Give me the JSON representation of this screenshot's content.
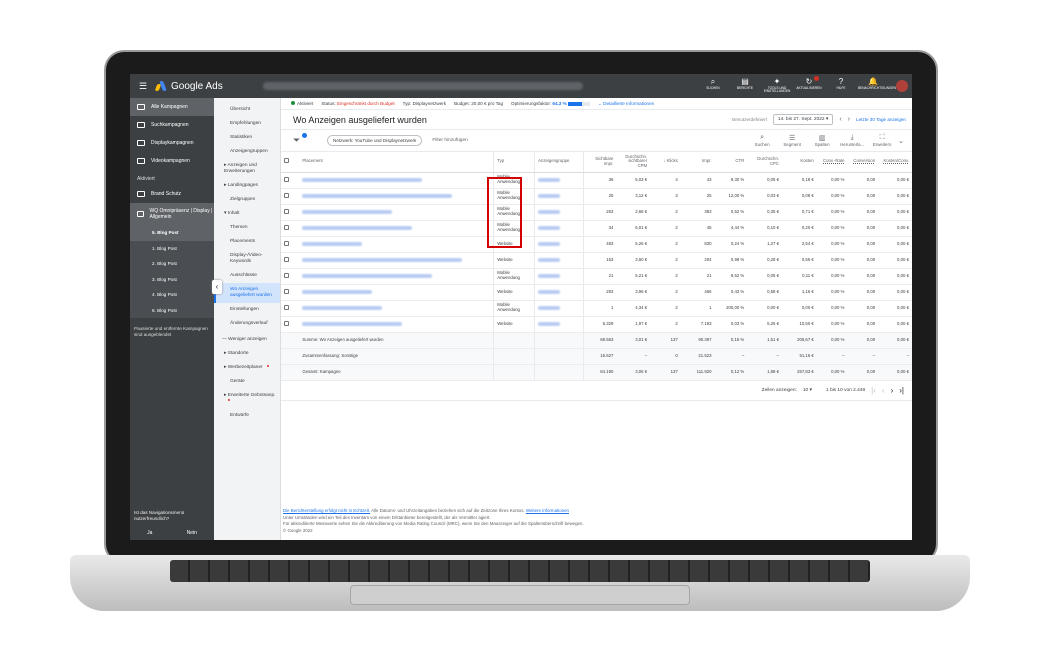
{
  "app": {
    "title": "Google Ads"
  },
  "topbar": {
    "actions": [
      {
        "icon": "search-icon",
        "glyph": "⌕",
        "label": "SUCHEN"
      },
      {
        "icon": "reports-icon",
        "glyph": "▤",
        "label": "BERICHTE"
      },
      {
        "icon": "wrench-icon",
        "glyph": "✦",
        "label": "TOOLS UND EINSTELLUNGEN"
      },
      {
        "icon": "refresh-icon",
        "glyph": "↻",
        "label": "AKTUALISIEREN"
      },
      {
        "icon": "help-icon",
        "glyph": "?",
        "label": "HILFE"
      },
      {
        "icon": "bell-icon",
        "glyph": "🔔",
        "label": "BENACHRICHTIGUNGEN"
      }
    ]
  },
  "leftnav": {
    "items": [
      {
        "label": "Alle Kampagnen"
      },
      {
        "label": "Suchkampagnen"
      },
      {
        "label": "Displaykampagnen"
      },
      {
        "label": "Videokampagnen"
      }
    ],
    "section_label": "Aktiviert",
    "campaigns": [
      {
        "label": "Brand Schutz"
      },
      {
        "label": "WQ Omnipräsenz | Display | Allgemein"
      }
    ],
    "adgroups": [
      "5. Blog Post",
      "1. Blog Post",
      "2. Blog Post",
      "3. Blog Post",
      "4. Blog Post",
      "6. Blog Post"
    ],
    "paused_note": "Pausierte und entfernte Kampagnen sind ausgeblendet",
    "feedback_question": "Ist das Navigationsmenü nutzerfreundlich?",
    "yes": "Ja",
    "no": "Nein"
  },
  "subnav": {
    "items": [
      {
        "label": "Übersicht"
      },
      {
        "label": "Empfehlungen"
      },
      {
        "label": "Statistiken"
      },
      {
        "label": "Anzeigengruppen"
      },
      {
        "label": "Anzeigen und Erweiterungen"
      },
      {
        "label": "Landingpages"
      },
      {
        "label": "Zielgruppen"
      },
      {
        "label": "Inhalt"
      },
      {
        "label": "Themen"
      },
      {
        "label": "Placements"
      },
      {
        "label": "Display-/Video-Keywords"
      },
      {
        "label": "Ausschlüsse"
      },
      {
        "label": "Wo Anzeigen ausgeliefert wurden"
      },
      {
        "label": "Einstellungen"
      },
      {
        "label": "Änderungsverlauf"
      }
    ],
    "less_label": "Weniger anzeigen",
    "extra": [
      {
        "label": "Standorte"
      },
      {
        "label": "Werbezeitplaner"
      },
      {
        "label": "Geräte"
      },
      {
        "label": "Erweiterte Gebotsanp."
      },
      {
        "label": "Entwürfe"
      }
    ]
  },
  "statusbar": {
    "status": "Aktiviert",
    "status_prefix": "Status:",
    "status_value": "Eingeschränkt durch Budget",
    "type_prefix": "Typ:",
    "type_value": "Displaynetzwerk",
    "budget_prefix": "Budget:",
    "budget_value": "20,00 € pro Tag",
    "opt_label": "Optimierungsfaktor:",
    "opt_value": "64,3 %",
    "opt_fraction": 0.643,
    "details_link": "Detaillierte Informationen",
    "colors": {
      "green": "#1e8e3e",
      "red": "#d93025",
      "blue": "#1a73e8"
    }
  },
  "header": {
    "title": "Wo Anzeigen ausgeliefert wurden",
    "date_label": "Benutzerdefiniert",
    "date_value": "14. bis 27. Sept. 2022",
    "last30": "Letzte 30 Tage anzeigen"
  },
  "toolbar": {
    "network_chip": "Netzwerk: YouTube und Displaynetzwerk",
    "add_filter": "Filter hinzufügen",
    "tools": [
      {
        "icon": "search-icon",
        "glyph": "⌕",
        "label": "Suchen"
      },
      {
        "icon": "segment-icon",
        "glyph": "☰",
        "label": "Segment"
      },
      {
        "icon": "columns-icon",
        "glyph": "▥",
        "label": "Spalten"
      },
      {
        "icon": "download-icon",
        "glyph": "⤓",
        "label": "Herunterla..."
      },
      {
        "icon": "expand-icon",
        "glyph": "⛶",
        "label": "Erweitern"
      }
    ]
  },
  "table": {
    "headers": [
      "Placement",
      "Typ",
      "Anzeigengruppe",
      "Sichtbare Impr.",
      "Durchschn. sichtbarer CPM",
      "Klicks",
      "Impr.",
      "CTR",
      "Durchschn. CPC",
      "Kosten",
      "Conv.-Rate",
      "Conversion",
      "Kosten/Conv."
    ],
    "rows": [
      {
        "typ": "Mobile Anwendung",
        "vimpr": "36",
        "vcpm": "5,03 €",
        "clicks": "4",
        "impr": "43",
        "ctr": "9,30 %",
        "cpc": "0,05 €",
        "cost": "0,18 €",
        "cr": "0,00 %",
        "conv": "0,00",
        "cpconv": "0,00 €"
      },
      {
        "typ": "Mobile Anwendung",
        "vimpr": "25",
        "vcpm": "3,12 €",
        "clicks": "3",
        "impr": "25",
        "ctr": "12,00 %",
        "cpc": "0,03 €",
        "cost": "0,08 €",
        "cr": "0,00 %",
        "conv": "0,00",
        "cpconv": "0,00 €"
      },
      {
        "typ": "Mobile Anwendung",
        "vimpr": "263",
        "vcpm": "2,68 €",
        "clicks": "2",
        "impr": "383",
        "ctr": "0,52 %",
        "cpc": "0,35 €",
        "cost": "0,71 €",
        "cr": "0,00 %",
        "conv": "0,00",
        "cpconv": "0,00 €"
      },
      {
        "typ": "Mobile Anwendung",
        "vimpr": "34",
        "vcpm": "6,01 €",
        "clicks": "2",
        "impr": "45",
        "ctr": "4,44 %",
        "cpc": "0,10 €",
        "cost": "0,20 €",
        "cr": "0,00 %",
        "conv": "0,00",
        "cpconv": "0,00 €"
      },
      {
        "typ": "Website",
        "vimpr": "483",
        "vcpm": "5,26 €",
        "clicks": "2",
        "impr": "830",
        "ctr": "0,24 %",
        "cpc": "1,27 €",
        "cost": "2,54 €",
        "cr": "0,00 %",
        "conv": "0,00",
        "cpconv": "0,00 €"
      },
      {
        "typ": "Website",
        "vimpr": "153",
        "vcpm": "3,60 €",
        "clicks": "2",
        "impr": "204",
        "ctr": "0,98 %",
        "cpc": "0,28 €",
        "cost": "0,55 €",
        "cr": "0,00 %",
        "conv": "0,00",
        "cpconv": "0,00 €"
      },
      {
        "typ": "Mobile Anwendung",
        "vimpr": "21",
        "vcpm": "5,21 €",
        "clicks": "2",
        "impr": "21",
        "ctr": "9,52 %",
        "cpc": "0,05 €",
        "cost": "0,11 €",
        "cr": "0,00 %",
        "conv": "0,00",
        "cpconv": "0,00 €"
      },
      {
        "typ": "Website",
        "vimpr": "293",
        "vcpm": "3,96 €",
        "clicks": "2",
        "impr": "466",
        "ctr": "0,43 %",
        "cpc": "0,58 €",
        "cost": "1,16 €",
        "cr": "0,00 %",
        "conv": "0,00",
        "cpconv": "0,00 €"
      },
      {
        "typ": "Mobile Anwendung",
        "vimpr": "1",
        "vcpm": "4,34 €",
        "clicks": "2",
        "impr": "1",
        "ctr": "200,00 %",
        "cpc": "0,00 €",
        "cost": "0,00 €",
        "cr": "0,00 %",
        "conv": "0,00",
        "cpconv": "0,00 €"
      },
      {
        "typ": "Website",
        "vimpr": "5.329",
        "vcpm": "1,97 €",
        "clicks": "2",
        "impr": "7.193",
        "ctr": "0,03 %",
        "cpc": "5,25 €",
        "cost": "10,50 €",
        "cr": "0,00 %",
        "conv": "0,00",
        "cpconv": "0,00 €"
      }
    ],
    "summary": [
      {
        "label": "Summe: Wo Anzeigen ausgeliefert wurden",
        "vimpr": "68.563",
        "vcpm": "3,01 €",
        "clicks": "137",
        "impr": "90.397",
        "ctr": "0,15 %",
        "cpc": "1,51 €",
        "cost": "206,67 €",
        "cr": "0,00 %",
        "conv": "0,00",
        "cpconv": "0,00 €"
      },
      {
        "label": "Zusammenfassung: Sonstige",
        "vimpr": "15.627",
        "vcpm": "–",
        "clicks": "0",
        "impr": "21.523",
        "ctr": "–",
        "cpc": "–",
        "cost": "51,16 €",
        "cr": "–",
        "conv": "–",
        "cpconv": "–"
      },
      {
        "label": "Gesamt: Kampagne",
        "vimpr": "84.190",
        "vcpm": "3,06 €",
        "clicks": "137",
        "impr": "111.920",
        "ctr": "0,12 %",
        "cpc": "1,88 €",
        "cost": "257,83 €",
        "cr": "0,00 %",
        "conv": "0,00",
        "cpconv": "0,00 €"
      }
    ]
  },
  "pager": {
    "rows_label": "Zeilen anzeigen:",
    "rows_value": "10",
    "range": "1 bis 10 von 2.448"
  },
  "footer": {
    "line1_link": "Die Berichterstellung erfolgt nicht in Echtzeit.",
    "line1_text": "Alle Datums- und Uhrzeitangaben beziehen sich auf die Zeitzone Ihres Kontos.",
    "line1_link2": "Weitere Informationen",
    "line2": "Unter Umständen wird ein Teil des Inventars von einem Drittanbieter bereitgestellt, der als Vermittler agiert.",
    "line3": "Für akkreditierte Messwerte sehen Sie die Akkreditierung von Media Rating Council (MRC), wenn Sie den Mauszeiger auf die Spaltenüberschrift bewegen.",
    "copyright": "© Google 2022"
  }
}
